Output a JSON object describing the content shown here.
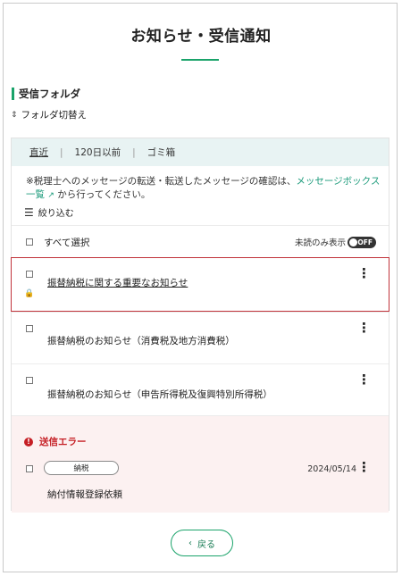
{
  "page": {
    "title": "お知らせ・受信通知"
  },
  "folder": {
    "heading": "受信フォルダ",
    "switch_icon": "updown-icon",
    "switch_label": "フォルダ切替え"
  },
  "tabs": [
    {
      "label": "直近",
      "active": true
    },
    {
      "label": "120日以前",
      "active": false
    },
    {
      "label": "ゴミ箱",
      "active": false
    }
  ],
  "notice": {
    "text_before": "※税理士へのメッセージの転送・転送したメッセージの確認は、",
    "link_text": "メッセージボックス一覧",
    "link_icon": "external-link-icon",
    "text_after": " から行ってください。"
  },
  "filter": {
    "icon": "sliders-icon",
    "label": "絞り込む"
  },
  "select_all": {
    "label": "すべて選択",
    "unread_only_label": "未読のみ表示",
    "toggle_label": "OFF",
    "toggle_on": false
  },
  "messages": [
    {
      "subject": "振替納税に関する重要なお知らせ",
      "locked": true,
      "highlighted": true,
      "underlined": true
    },
    {
      "subject": "振替納税のお知らせ（消費税及地方消費税）",
      "locked": false,
      "highlighted": false,
      "underlined": false
    },
    {
      "subject": "振替納税のお知らせ（申告所得税及復興特別所得税）",
      "locked": false,
      "highlighted": false,
      "underlined": false
    }
  ],
  "error_message": {
    "status": "送信エラー",
    "tag": "納税",
    "date": "2024/05/14",
    "subject": "納付情報登録依頼"
  },
  "back_button": {
    "label": "戻る"
  },
  "colors": {
    "accent_green": "#1aa36a",
    "error_red": "#c51e24",
    "highlight_border": "#c0333a",
    "tab_bg": "#e8f3f3",
    "error_bg": "#fcf1f1"
  }
}
